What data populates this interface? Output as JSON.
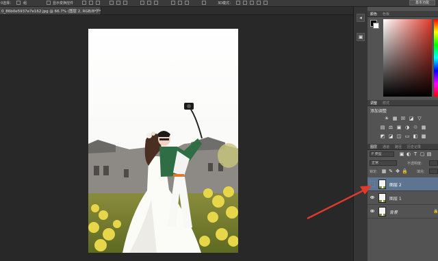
{
  "optionbar": {
    "select_label": "0选择：",
    "group_label": "组",
    "show_transform": "显示变换控件",
    "mode_3d": "3D模式：",
    "workspace": "基本功能"
  },
  "doc": {
    "tab_label": "0_86b0e5937e7e162.jpg @ 66.7% (图层 2, RGB/8*) *",
    "close_glyph": "×"
  },
  "dock": {
    "icons": [
      "panel-toggle-icon",
      "color-panel-icon"
    ]
  },
  "panels": {
    "color_tabs": [
      "颜色",
      "色板"
    ],
    "adjust_tabs": [
      "调整",
      "样式"
    ],
    "adjust_title": "添加调整",
    "adjust_icons": [
      [
        "☀",
        "▦",
        "☒",
        "◪",
        "▽"
      ],
      [
        "▤",
        "⚖",
        "▣",
        "◑",
        "♲",
        "▦"
      ],
      [
        "◩",
        "◪",
        "◫",
        "▭",
        "◧",
        "▩"
      ]
    ],
    "layers_tabs": [
      "图层",
      "通道",
      "路径",
      "历史记录"
    ],
    "filter_kind": "P 类型",
    "blend_mode": "正常",
    "opacity_label": "不透明度:",
    "lock_label": "锁定:",
    "fill_label": "填充:",
    "layers": [
      {
        "name": "图层 2",
        "visible": false,
        "selected": true,
        "locked": false
      },
      {
        "name": "图层 1",
        "visible": true,
        "selected": false,
        "locked": false
      },
      {
        "name": "背景",
        "visible": true,
        "selected": false,
        "locked": true
      }
    ],
    "lock_glyph": "🔒"
  },
  "colors": {
    "accent": "#e03a2c",
    "selected_layer": "#5d7590",
    "panel_bg": "#535353",
    "canvas_bg": "#282828"
  }
}
